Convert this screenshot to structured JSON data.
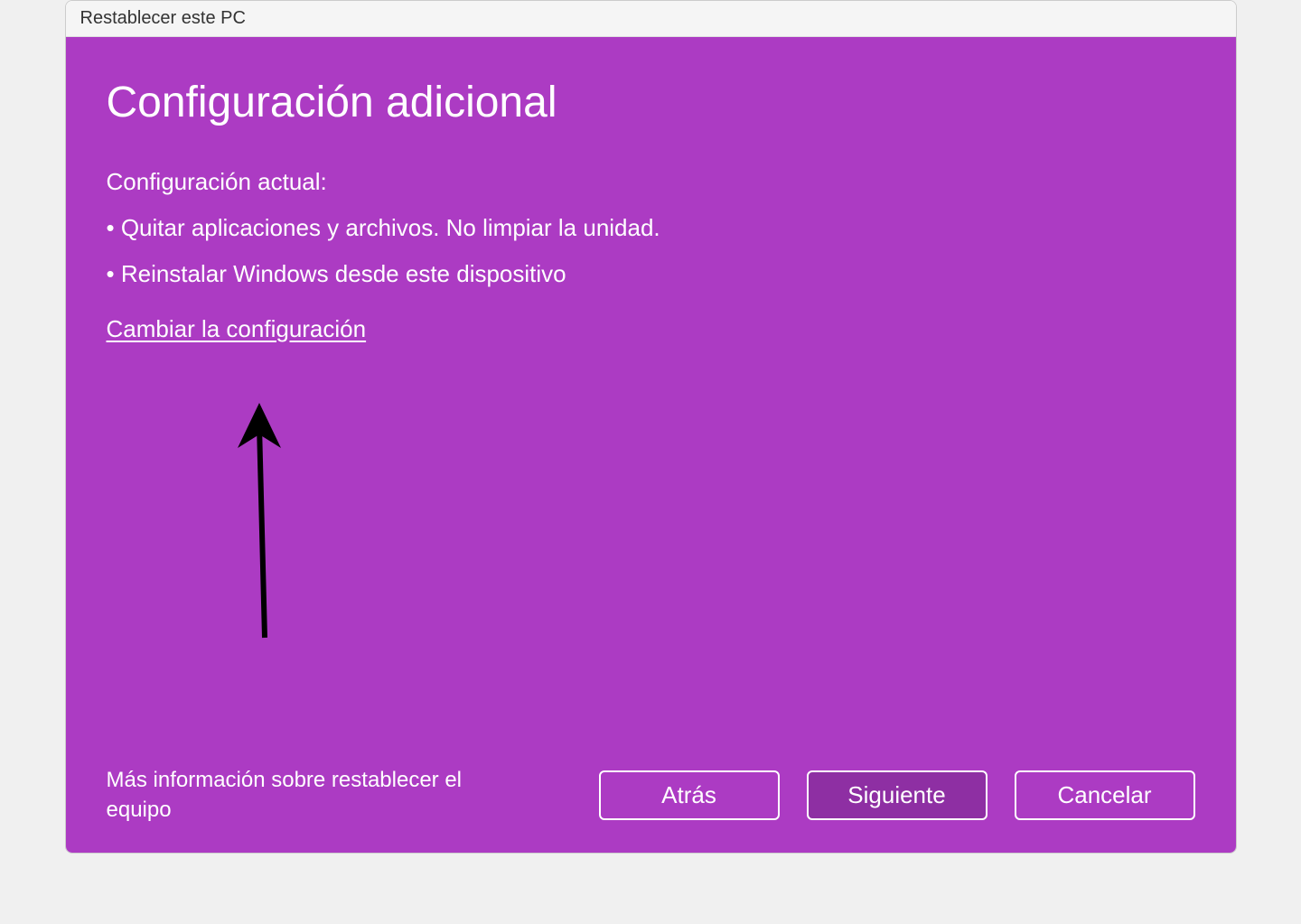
{
  "titlebar": {
    "title": "Restablecer este PC"
  },
  "main": {
    "heading": "Configuración adicional",
    "subheading": "Configuración actual:",
    "bullets": [
      "• Quitar aplicaciones y archivos. No limpiar la unidad.",
      "• Reinstalar Windows desde este dispositivo"
    ],
    "change_link": "Cambiar la configuración"
  },
  "footer": {
    "info_link": "Más información sobre restablecer el equipo",
    "buttons": {
      "back": "Atrás",
      "next": "Siguiente",
      "cancel": "Cancelar"
    }
  },
  "colors": {
    "accent": "#ac3bc3",
    "primary_button": "#8e2fa3"
  }
}
